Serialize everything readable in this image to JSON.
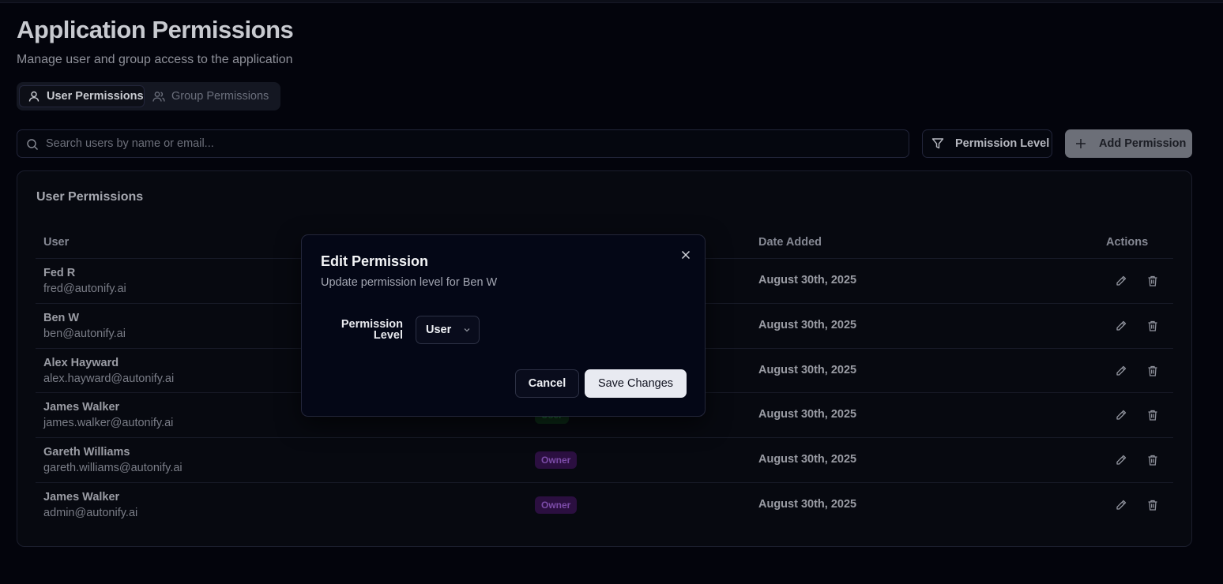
{
  "page": {
    "title": "Application Permissions",
    "subtitle": "Manage user and group access to the application"
  },
  "tabs": [
    {
      "label": "User Permissions",
      "icon": "user-icon",
      "active": true
    },
    {
      "label": "Group Permissions",
      "icon": "users-icon",
      "active": false
    }
  ],
  "toolbar": {
    "search_placeholder": "Search users by name or email...",
    "search_value": "",
    "filter_label": "Permission Level",
    "add_label": "Add Permission"
  },
  "table": {
    "title": "User Permissions",
    "columns": {
      "user": "User",
      "date": "Date Added",
      "actions": "Actions"
    },
    "rows": [
      {
        "name": "Fed R",
        "email": "fred@autonify.ai",
        "role": "",
        "date": "August 30th, 2025"
      },
      {
        "name": "Ben W",
        "email": "ben@autonify.ai",
        "role": "",
        "date": "August 30th, 2025"
      },
      {
        "name": "Alex Hayward",
        "email": "alex.hayward@autonify.ai",
        "role": "",
        "date": "August 30th, 2025"
      },
      {
        "name": "James Walker",
        "email": "james.walker@autonify.ai",
        "role": "User",
        "date": "August 30th, 2025"
      },
      {
        "name": "Gareth Williams",
        "email": "gareth.williams@autonify.ai",
        "role": "Owner",
        "date": "August 30th, 2025"
      },
      {
        "name": "James Walker",
        "email": "admin@autonify.ai",
        "role": "Owner",
        "date": "August 30th, 2025"
      }
    ]
  },
  "modal": {
    "title": "Edit Permission",
    "description": "Update permission level for Ben W",
    "field_label": "Permission Level",
    "selected_value": "User",
    "cancel_label": "Cancel",
    "save_label": "Save Changes"
  },
  "colors": {
    "background": "#03040c",
    "owner_badge": "#2b0f40",
    "user_badge": "#0c2a16",
    "primary_button": "#e8eaf1"
  }
}
